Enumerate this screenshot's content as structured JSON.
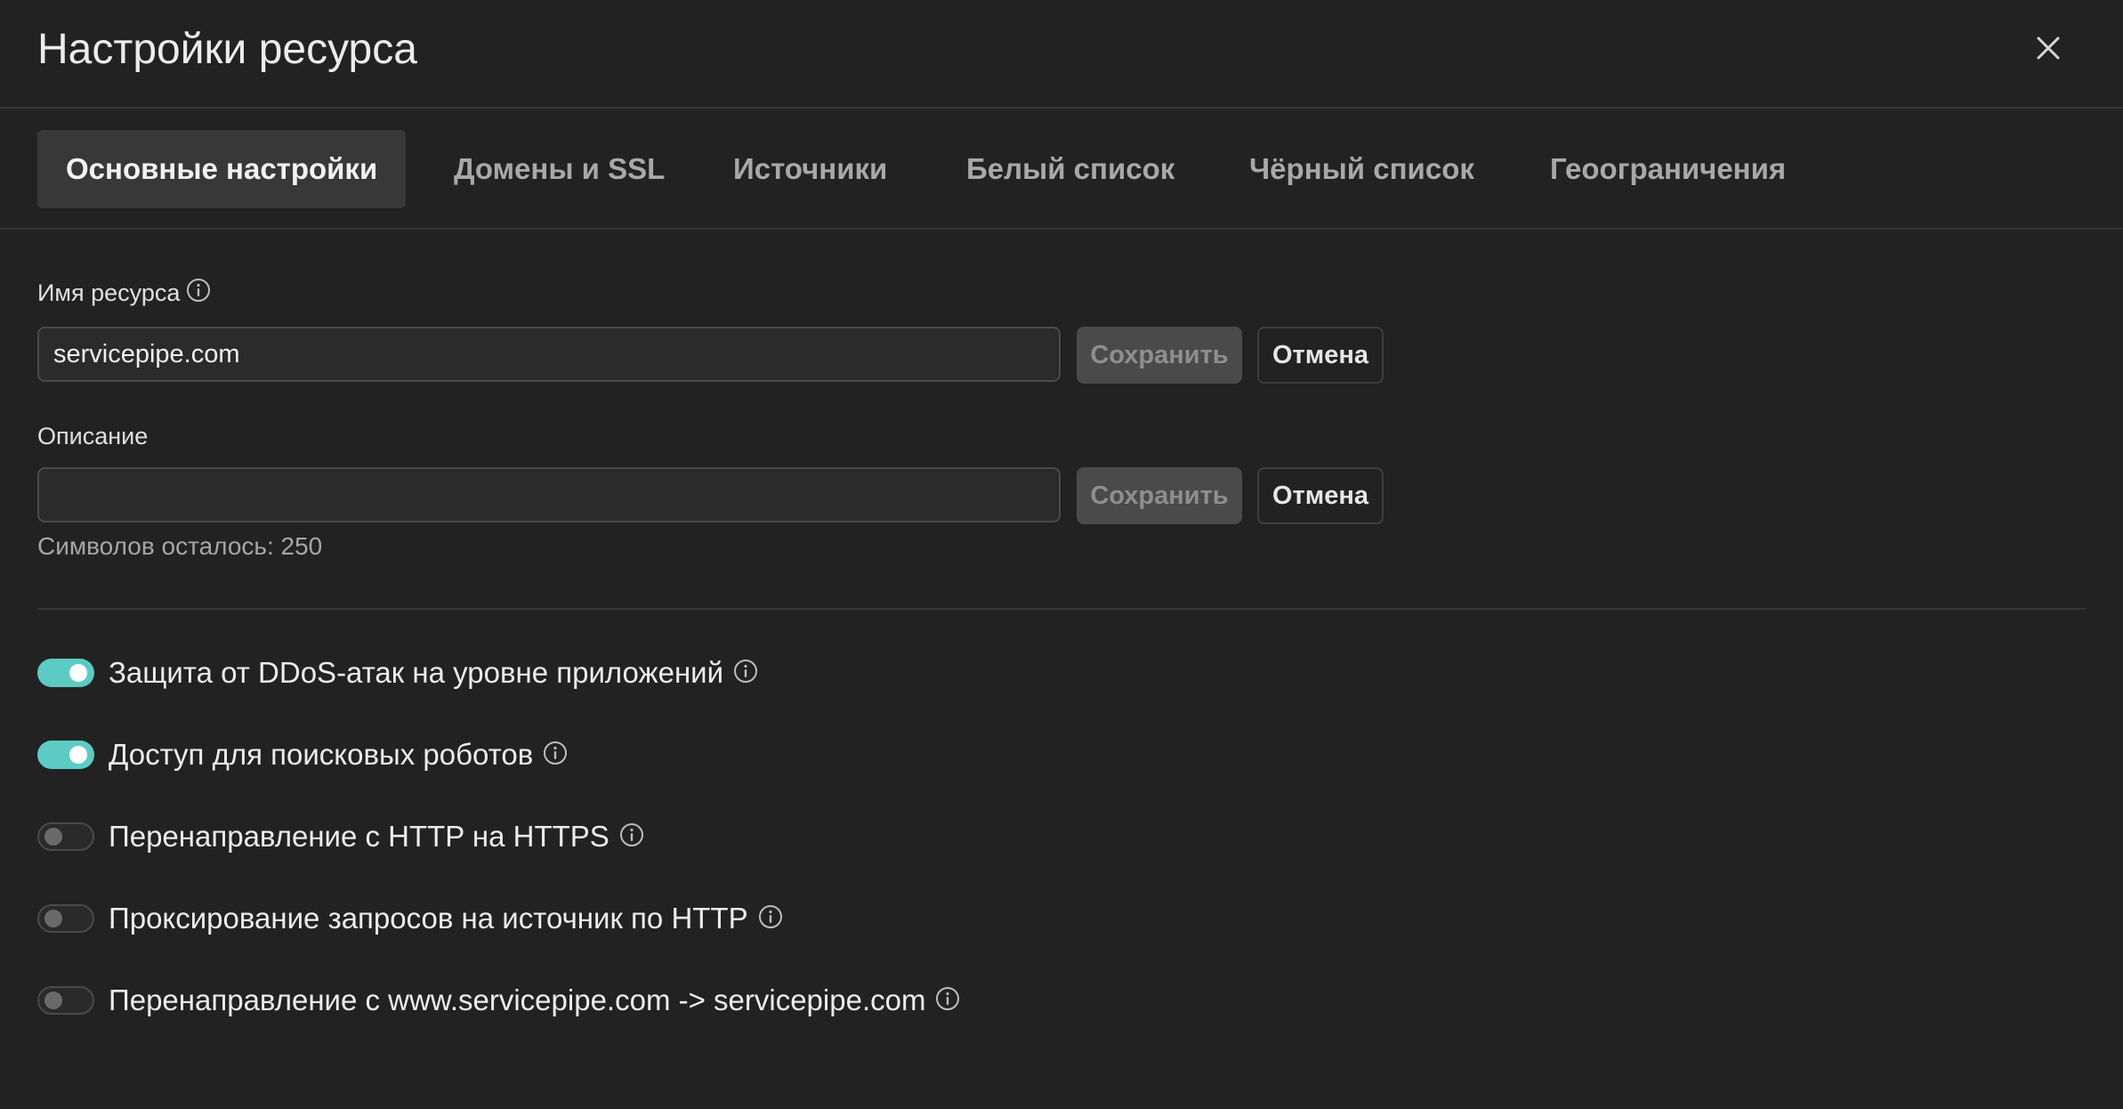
{
  "dialog": {
    "title": "Настройки ресурса",
    "close_icon": "close-icon"
  },
  "tabs": [
    {
      "label": "Основные настройки",
      "active": true
    },
    {
      "label": "Домены и SSL",
      "active": false
    },
    {
      "label": "Источники",
      "active": false
    },
    {
      "label": "Белый список",
      "active": false
    },
    {
      "label": "Чёрный список",
      "active": false
    },
    {
      "label": "Геоограничения",
      "active": false
    }
  ],
  "resource_name": {
    "label": "Имя ресурса",
    "value": "servicepipe.com",
    "info_icon": "info-icon",
    "save_label": "Сохранить",
    "cancel_label": "Отмена"
  },
  "description": {
    "label": "Описание",
    "value": "",
    "save_label": "Сохранить",
    "cancel_label": "Отмена",
    "chars_left": "Символов осталось: 250"
  },
  "toggles": [
    {
      "label": "Защита от DDoS-атак на уровне приложений",
      "enabled": true
    },
    {
      "label": "Доступ для поисковых роботов",
      "enabled": true
    },
    {
      "label": "Перенаправление с HTTP на HTTPS",
      "enabled": false
    },
    {
      "label": "Проксирование запросов на источник по HTTP",
      "enabled": false
    },
    {
      "label": "Перенаправление с www.servicepipe.com -> servicepipe.com",
      "enabled": false
    }
  ],
  "colors": {
    "background": "#222222",
    "accent_toggle_on": "#5ccbc3",
    "active_tab_bg": "#383838",
    "save_button_bg": "#4a4a4a"
  }
}
